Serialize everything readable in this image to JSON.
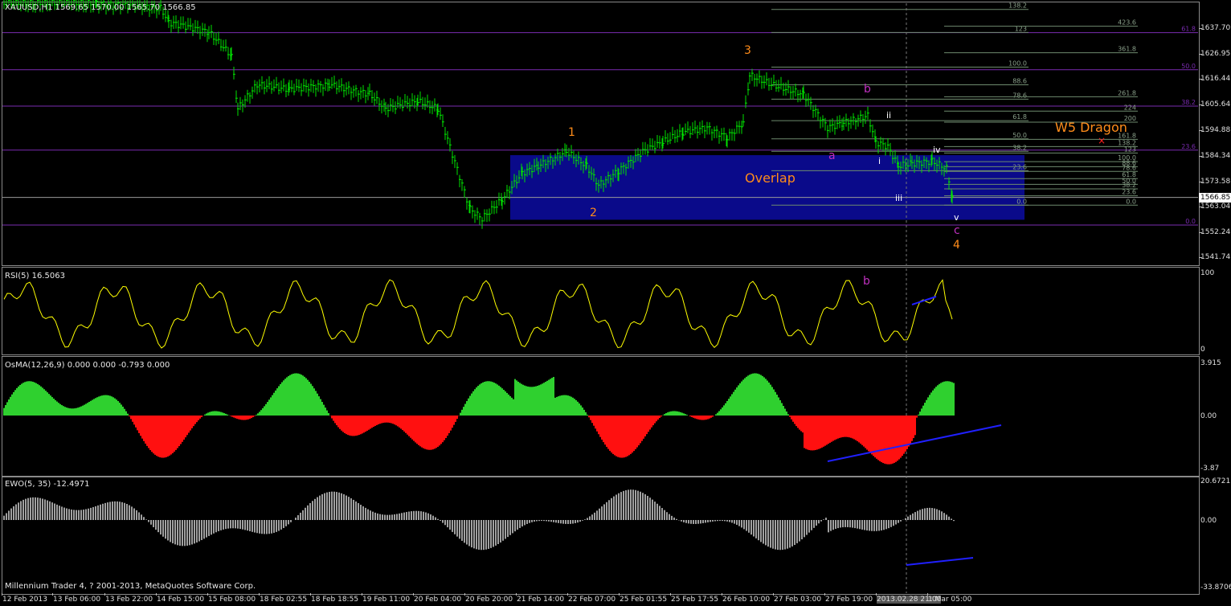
{
  "window": {
    "title": "XAUUSD,H1  1569.65 1570.00 1565.70 1566.85"
  },
  "colors": {
    "candle": "#00e000",
    "grid": "#7a2bb0",
    "fib": "#6e8a6e",
    "rsi": "#ffff00",
    "osma_up": "#2fd02f",
    "osma_dn": "#ff1010",
    "ewo": "#a0a0a0",
    "trend": "#2020ff",
    "wave_orange": "#ff8c1a",
    "wave_magenta": "#c030c0",
    "overlap_box": "#0a0a8a"
  },
  "price_axis": {
    "labels": [
      "1637.70",
      "1626.95",
      "1616.44",
      "1605.64",
      "1594.88",
      "1584.34",
      "1573.58",
      "1563.04",
      "1552.24",
      "1541.74"
    ],
    "current": "1566.85",
    "min": 1538.5,
    "max": 1648
  },
  "h_levels": [
    {
      "price": 1635.7,
      "label": "61.8"
    },
    {
      "price": 1620.2,
      "label": "50.0"
    },
    {
      "price": 1605.0,
      "label": "38.2"
    },
    {
      "price": 1586.6,
      "label": "23.6"
    },
    {
      "price": 1555.3,
      "label": "0.0"
    }
  ],
  "fib_left": [
    {
      "price": 1645.4,
      "label": "138.2"
    },
    {
      "price": 1635.8,
      "label": "123"
    },
    {
      "price": 1621.3,
      "label": "100.0"
    },
    {
      "price": 1613.9,
      "label": "88.6"
    },
    {
      "price": 1607.9,
      "label": "78.6"
    },
    {
      "price": 1598.9,
      "label": "61.8"
    },
    {
      "price": 1591.3,
      "label": "50.0"
    },
    {
      "price": 1586.1,
      "label": "38.2"
    },
    {
      "price": 1578.0,
      "label": "23.6"
    },
    {
      "price": 1563.6,
      "label": "0.0"
    }
  ],
  "fib_right": [
    {
      "price": 1638.4,
      "label": "423.6"
    },
    {
      "price": 1627.3,
      "label": "361.8"
    },
    {
      "price": 1608.9,
      "label": "261.8"
    },
    {
      "price": 1602.9,
      "label": "224"
    },
    {
      "price": 1598.3,
      "label": "200"
    },
    {
      "price": 1591.1,
      "label": "161.8"
    },
    {
      "price": 1588.1,
      "label": "138.2"
    },
    {
      "price": 1585.4,
      "label": "123"
    },
    {
      "price": 1581.8,
      "label": "100.0"
    },
    {
      "price": 1579.7,
      "label": "88.6"
    },
    {
      "price": 1577.7,
      "label": "78.6"
    },
    {
      "price": 1574.7,
      "label": "61.8"
    },
    {
      "price": 1572.3,
      "label": "50.0"
    },
    {
      "price": 1570.4,
      "label": "38.2"
    },
    {
      "price": 1567.5,
      "label": "23.6"
    },
    {
      "price": 1563.6,
      "label": "0.0"
    }
  ],
  "waves": [
    {
      "label": "1",
      "color": "orange"
    },
    {
      "label": "2",
      "color": "orange"
    },
    {
      "label": "3",
      "color": "orange"
    },
    {
      "label": "4",
      "color": "orange"
    },
    {
      "label": "a",
      "color": "magenta"
    },
    {
      "label": "b",
      "color": "magenta"
    },
    {
      "label": "c",
      "color": "magenta"
    },
    {
      "label": "i",
      "color": "white"
    },
    {
      "label": "ii",
      "color": "white"
    },
    {
      "label": "iii",
      "color": "white"
    },
    {
      "label": "iv",
      "color": "white"
    },
    {
      "label": "v",
      "color": "white"
    }
  ],
  "annotations": {
    "overlap": "Overlap",
    "w5": "W5 Dragon",
    "w5_marker": "×",
    "rsi_b": "b"
  },
  "rsi": {
    "title": "RSI(5) 16.5063",
    "axis": [
      "100",
      "0"
    ]
  },
  "osma": {
    "title": "OsMA(12,26,9) 0.000 0.000 -0.793 0.000",
    "axis": [
      "3.915",
      "0.00",
      "-3.87"
    ]
  },
  "ewo": {
    "title": "EWO(5, 35) -12.4971",
    "axis": [
      "20.6721",
      "0.00",
      "-33.8706"
    ]
  },
  "time_axis": [
    "12 Feb 2013",
    "13 Feb 06:00",
    "13 Feb 22:00",
    "14 Feb 15:00",
    "15 Feb 08:00",
    "18 Feb 02:55",
    "18 Feb 18:55",
    "19 Feb 11:00",
    "20 Feb 04:00",
    "20 Feb 20:00",
    "21 Feb 14:00",
    "22 Feb 07:00",
    "25 Feb 01:55",
    "25 Feb 17:55",
    "26 Feb 10:00",
    "27 Feb 03:00",
    "27 Feb 19:00",
    "2013.02.28 21:00",
    "1 Mar 05:00"
  ],
  "footer": "Millennium Trader 4, ? 2001-2013, MetaQuotes Software Corp."
}
